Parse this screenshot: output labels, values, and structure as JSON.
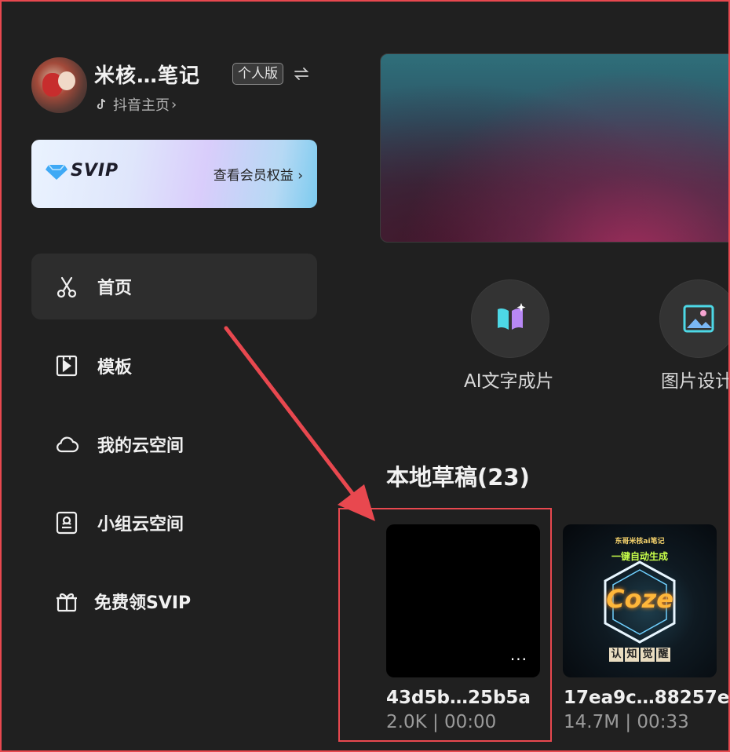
{
  "profile": {
    "username": "米核…笔记",
    "edition": "个人版",
    "douyin_link": "抖音主页",
    "douyin_chevron": "›"
  },
  "svip_card": {
    "logo_text": "SVIP",
    "link_label": "查看会员权益",
    "link_chevron": "›"
  },
  "nav": {
    "home": "首页",
    "templates": "模板",
    "my_cloud": "我的云空间",
    "team_cloud": "小组云空间",
    "free_svip": "免费领SVIP"
  },
  "quick_actions": [
    {
      "label": "AI文字成片",
      "icon": "book-sparkle-icon"
    },
    {
      "label": "图片设计",
      "icon": "image-icon"
    }
  ],
  "drafts": {
    "title": "本地草稿(23)",
    "items": [
      {
        "name": "43d5b…25b5a",
        "meta": "2.0K | 00:00",
        "more": "···"
      },
      {
        "name": "17ea9c…88257e",
        "meta": "14.7M | 00:33",
        "thumb": {
          "top_text": "东哥米核ai笔记",
          "subtitle": "一键自动生成",
          "word": "Coze",
          "bottom": [
            "认",
            "知",
            "觉",
            "醒"
          ]
        }
      }
    ]
  },
  "colors": {
    "annotation_red": "#e8484f",
    "background": "#202020",
    "nav_active": "#2d2d2d"
  }
}
